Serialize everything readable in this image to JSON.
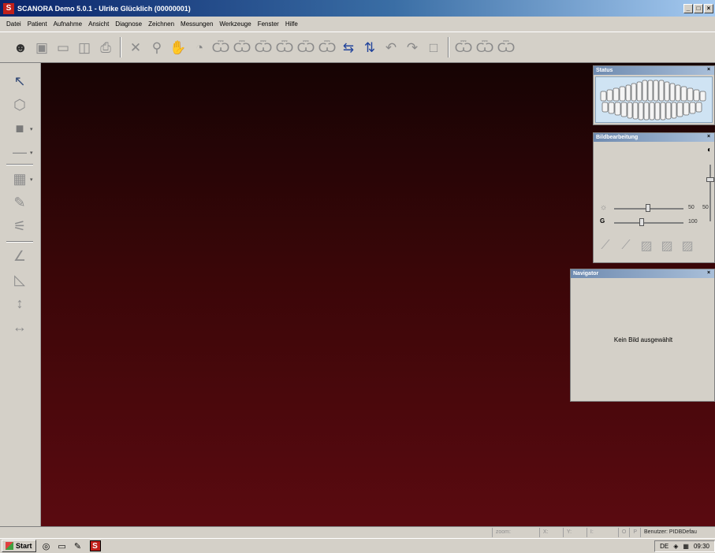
{
  "window": {
    "logo_letter": "S",
    "title": "SCANORA Demo 5.0.1 - Ulrike Glücklich (00000001)",
    "min_glyph": "_",
    "max_glyph": "□",
    "close_glyph": "×"
  },
  "menu": [
    "Datei",
    "Patient",
    "Aufnahme",
    "Ansicht",
    "Diagnose",
    "Zeichnen",
    "Messungen",
    "Werkzeuge",
    "Fenster",
    "Hilfe"
  ],
  "toolbar_icons": {
    "patient": "☻",
    "open": "▣",
    "save": "▭",
    "copy": "◫",
    "print": "⎙",
    "fullscreen": "✕",
    "zoom": "⚲",
    "pan": "✋",
    "contrast": "◔",
    "tooth1": "Ѿ",
    "tooth2": "Ѿ",
    "tooth3": "Ѿ",
    "tooth4": "Ѿ",
    "tooth5": "Ѿ",
    "tooth6": "Ѿ",
    "flip_h": "⇆",
    "flip_v": "⇅",
    "undo": "↶",
    "redo": "↷",
    "crop": "□",
    "tooth7": "Ѿ",
    "tooth8": "Ѿ",
    "tooth9": "Ѿ"
  },
  "side_icons": {
    "pointer": "↖",
    "eraser": "⬡",
    "fill": "■",
    "line": "―",
    "tool1": "▦",
    "tool2": "✎",
    "tool3": "⚟",
    "angle": "∠",
    "triangle": "◺",
    "measure_v": "↕",
    "measure_h": "↔"
  },
  "panels": {
    "status": {
      "title": "Status",
      "close": "×"
    },
    "bildbearbeitung": {
      "title": "Bildbearbeitung",
      "close": "×",
      "contrast_icon": "◐",
      "brightness_icon": "☼",
      "gamma_label": "G",
      "brightness_value": "50",
      "brightness_value2": "50",
      "gamma_value": "100"
    },
    "navigator": {
      "title": "Navigator",
      "close": "×",
      "empty_text": "Kein Bild ausgewählt"
    }
  },
  "statusbar": {
    "zoom": "zoom:",
    "x": "X:",
    "y": "Y:",
    "i": "I:",
    "o": "O",
    "p": "P",
    "user": "Benutzer: PIDBDefau"
  },
  "taskbar": {
    "start": "Start",
    "app_letter": "S",
    "lang": "DE",
    "clock": "09:30"
  },
  "colors": {
    "canvas_top": "#160404",
    "canvas_bottom": "#5a0a10",
    "title_blue": "#0a246a"
  }
}
